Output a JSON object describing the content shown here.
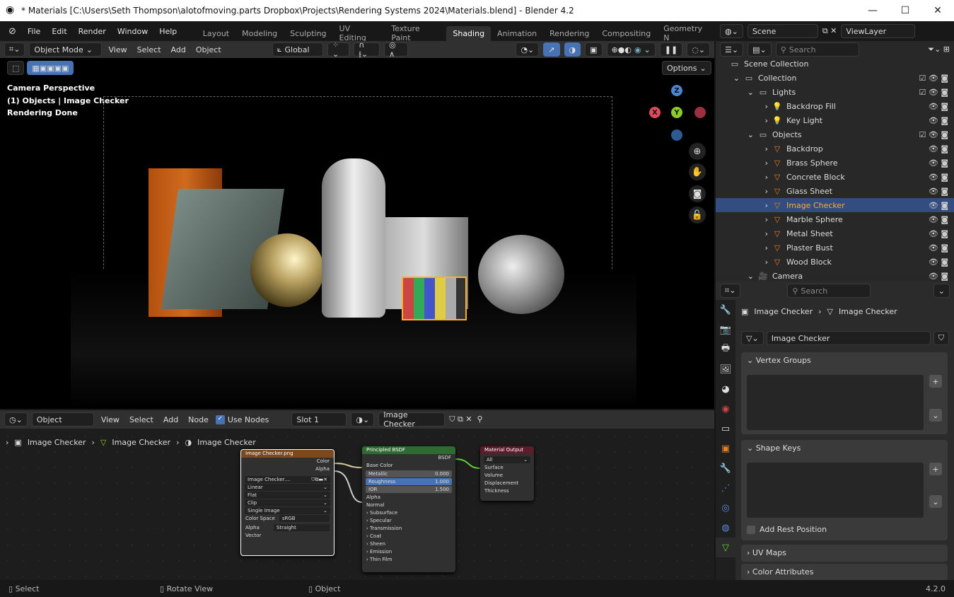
{
  "window": {
    "title": "* Materials [C:\\Users\\Seth Thompson\\alotofmoving.parts Dropbox\\Projects\\Rendering Systems 2024\\Materials.blend] - Blender 4.2",
    "minimize": "—",
    "maximize": "☐",
    "close": "✕"
  },
  "menu": [
    "File",
    "Edit",
    "Render",
    "Window",
    "Help"
  ],
  "workspaces": [
    "Layout",
    "Modeling",
    "Sculpting",
    "UV Editing",
    "Texture Paint",
    "Shading",
    "Animation",
    "Rendering",
    "Compositing",
    "Geometry N"
  ],
  "active_workspace": "Shading",
  "scene": "Scene",
  "view_layer": "ViewLayer",
  "viewport": {
    "mode": "Object Mode",
    "menus": [
      "View",
      "Select",
      "Add",
      "Object"
    ],
    "orientation": "Global",
    "options": "Options",
    "overlay": [
      "Camera Perspective",
      "(1) Objects | Image Checker",
      "Rendering Done"
    ],
    "gizmo": {
      "x": "X",
      "y": "Y",
      "z": "Z"
    }
  },
  "node_editor": {
    "type": "Object",
    "menus": [
      "View",
      "Select",
      "Add",
      "Node"
    ],
    "use_nodes": "Use Nodes",
    "slot": "Slot 1",
    "material": "Image Checker",
    "breadcrumb": [
      "Image Checker",
      "Image Checker",
      "Image Checker"
    ],
    "image_node": {
      "title": "Image Checker.png",
      "outputs": [
        "Color",
        "Alpha"
      ],
      "image": "Image Checker....",
      "interpolation": "Linear",
      "projection": "Flat",
      "extension": "Clip",
      "source": "Single Image",
      "color_space_label": "Color Space",
      "color_space": "sRGB",
      "alpha_label": "Alpha",
      "alpha": "Straight",
      "input": "Vector"
    },
    "bsdf_node": {
      "title": "Principled BSDF",
      "output": "BSDF",
      "base_color": "Base Color",
      "fields": [
        {
          "label": "Metallic",
          "value": "0.000"
        },
        {
          "label": "Roughness",
          "value": "1.000"
        },
        {
          "label": "IOR",
          "value": "1.500"
        }
      ],
      "alpha": "Alpha",
      "normal": "Normal",
      "panels": [
        "Subsurface",
        "Specular",
        "Transmission",
        "Coat",
        "Sheen",
        "Emission",
        "Thin Film"
      ]
    },
    "output_node": {
      "title": "Material Output",
      "target": "All",
      "inputs": [
        "Surface",
        "Volume",
        "Displacement",
        "Thickness"
      ]
    }
  },
  "outliner": {
    "search_placeholder": "Search",
    "items": [
      {
        "label": "Scene Collection",
        "depth": 0,
        "icon": "collection"
      },
      {
        "label": "Collection",
        "depth": 1,
        "icon": "collection",
        "check": true
      },
      {
        "label": "Lights",
        "depth": 2,
        "icon": "collection",
        "check": true
      },
      {
        "label": "Backdrop Fill",
        "depth": 3,
        "icon": "light"
      },
      {
        "label": "Key Light",
        "depth": 3,
        "icon": "light"
      },
      {
        "label": "Objects",
        "depth": 2,
        "icon": "collection",
        "check": true
      },
      {
        "label": "Backdrop",
        "depth": 3,
        "icon": "mesh"
      },
      {
        "label": "Brass Sphere",
        "depth": 3,
        "icon": "mesh"
      },
      {
        "label": "Concrete  Block",
        "depth": 3,
        "icon": "mesh"
      },
      {
        "label": "Glass Sheet",
        "depth": 3,
        "icon": "mesh"
      },
      {
        "label": "Image Checker",
        "depth": 3,
        "icon": "mesh",
        "selected": true
      },
      {
        "label": "Marble Sphere",
        "depth": 3,
        "icon": "mesh"
      },
      {
        "label": "Metal Sheet",
        "depth": 3,
        "icon": "mesh"
      },
      {
        "label": "Plaster Bust",
        "depth": 3,
        "icon": "mesh"
      },
      {
        "label": "Wood Block",
        "depth": 3,
        "icon": "mesh"
      },
      {
        "label": "Camera",
        "depth": 2,
        "icon": "camera"
      }
    ]
  },
  "properties": {
    "search_placeholder": "Search",
    "object": "Image Checker",
    "data": "Image Checker",
    "mesh_name": "Image Checker",
    "panels": [
      "Vertex Groups",
      "Shape Keys",
      "UV Maps",
      "Color Attributes"
    ],
    "add_rest_position": "Add Rest Position"
  },
  "status": {
    "select": "Select",
    "rotate": "Rotate View",
    "object": "Object",
    "version": "4.2.0"
  },
  "colors": {
    "accent": "#4772b3",
    "selection": "#334d80",
    "highlight": "#ffaf29"
  }
}
